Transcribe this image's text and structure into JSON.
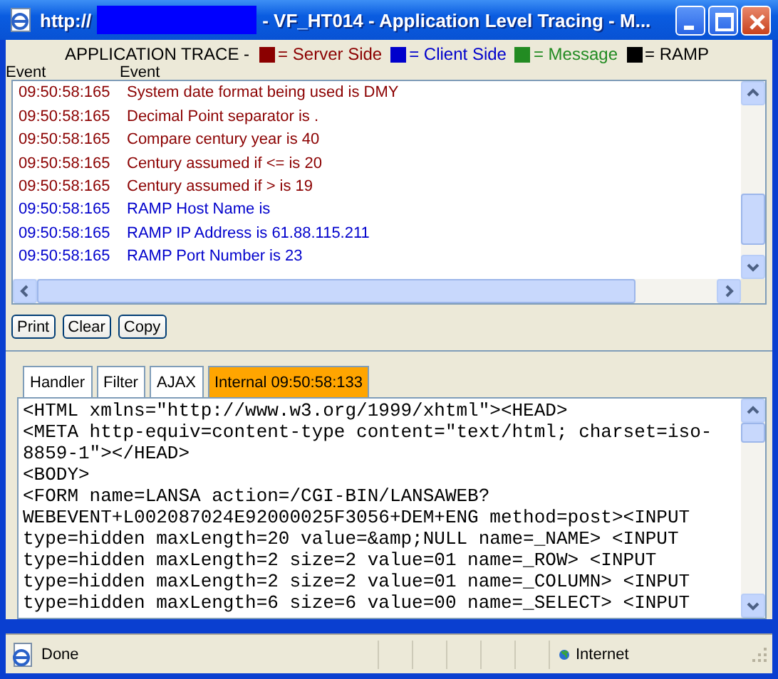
{
  "window": {
    "title_prefix": "http://",
    "title": "- VF_HT014 - Application Level Tracing - M..."
  },
  "legend": {
    "title": "APPLICATION TRACE -",
    "items": [
      {
        "label": "= Server Side",
        "color": "#8b0000"
      },
      {
        "label": "= Client Side",
        "color": "#0000cc"
      },
      {
        "label": "= Message",
        "color": "#228b22"
      },
      {
        "label": "= RAMP",
        "color": "#000000"
      }
    ]
  },
  "log": {
    "columns": [
      "Event",
      "Event"
    ],
    "entries": [
      {
        "time": "09:50:58:165",
        "message": "System date format being used is DMY",
        "color": "#8b0000"
      },
      {
        "time": "09:50:58:165",
        "message": "Decimal Point separator is .",
        "color": "#8b0000"
      },
      {
        "time": "09:50:58:165",
        "message": "Compare century year is 40",
        "color": "#8b0000"
      },
      {
        "time": "09:50:58:165",
        "message": "Century assumed if <= is 20",
        "color": "#8b0000"
      },
      {
        "time": "09:50:58:165",
        "message": "Century assumed if >  is 19",
        "color": "#8b0000"
      },
      {
        "time": "09:50:58:165",
        "message": "RAMP Host Name is",
        "color": "#0000cc"
      },
      {
        "time": "09:50:58:165",
        "message": "RAMP IP Address is 61.88.115.211",
        "color": "#0000cc"
      },
      {
        "time": "09:50:58:165",
        "message": "RAMP Port Number is 23",
        "color": "#0000cc"
      }
    ]
  },
  "buttons": [
    "Print",
    "Clear",
    "Copy"
  ],
  "tabs": [
    {
      "label": "Handler",
      "selected": false
    },
    {
      "label": "Filter",
      "selected": false
    },
    {
      "label": "AJAX",
      "selected": false
    },
    {
      "label": "Internal 09:50:58:133",
      "selected": true
    }
  ],
  "code_lines": [
    "<HTML xmlns=\"http://www.w3.org/1999/xhtml\"><HEAD>",
    "<META http-equiv=content-type content=\"text/html; charset=iso-",
    "8859-1\"></HEAD>",
    "<BODY>",
    "<FORM name=LANSA action=/CGI-BIN/LANSAWEB?",
    "WEBEVENT+L002087024E92000025F3056+DEM+ENG method=post><INPUT",
    "type=hidden maxLength=20 value=&amp;NULL name=_NAME> <INPUT",
    "type=hidden maxLength=2 size=2 value=01 name=_ROW> <INPUT",
    "type=hidden maxLength=2 size=2 value=01 name=_COLUMN> <INPUT",
    "type=hidden maxLength=6 size=6 value=00 name=_SELECT> <INPUT"
  ],
  "status_bar": {
    "text": "Done",
    "zone": "Internet"
  }
}
